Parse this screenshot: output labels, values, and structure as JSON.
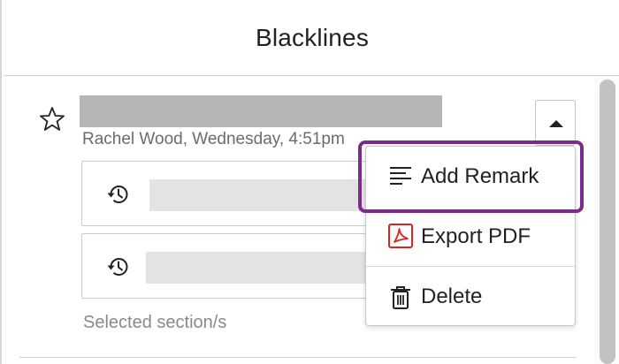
{
  "header": {
    "title": "Blacklines"
  },
  "entry": {
    "meta": "Rachel Wood, Wednesday, 4:51pm",
    "star_icon": "star-outline-icon",
    "collapse_icon": "caret-up-icon",
    "versions": [
      {
        "icon": "history-icon"
      },
      {
        "icon": "history-icon"
      }
    ],
    "selected_label": "Selected section/s"
  },
  "menu": {
    "items": [
      {
        "label": "Add Remark",
        "icon": "remark-lines-icon"
      },
      {
        "label": "Export PDF",
        "icon": "pdf-icon",
        "icon_color": "#d9261c"
      },
      {
        "label": "Delete",
        "icon": "trash-icon"
      }
    ],
    "highlight_color": "#7b2b8e"
  }
}
